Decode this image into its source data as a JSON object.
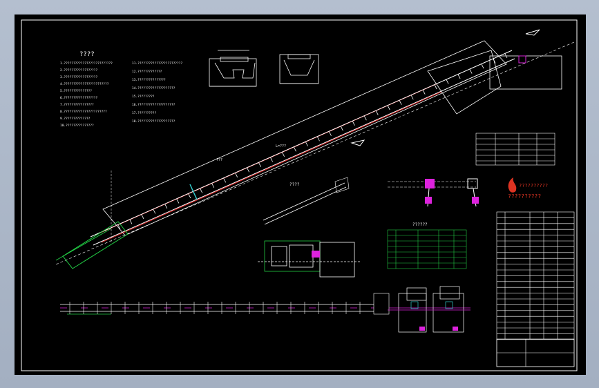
{
  "notes": {
    "heading": "????",
    "lines": [
      "1.??????????????????????????",
      "2.??????????????????",
      "3.??????????????????",
      "4.????????????????????????",
      "5.???????????????",
      "6.??????????????????",
      "7.????????????????",
      "8.???????????????????????",
      "9.??????????????",
      "10.???????????????"
    ],
    "lines2": [
      "11.????????????????????????",
      "12.?????????????",
      "13.???????????????",
      "14.????????????????????",
      "15.?????????",
      "16.????????????????????",
      "17.??????????",
      "18.????????????????????"
    ]
  },
  "conveyor": {
    "length_label": "L=???",
    "incline_label": "???"
  },
  "callouts": {
    "detail_a": "????",
    "detail_table": "??????",
    "legend": "?????????",
    "logo_text": "??????????"
  },
  "colors": {
    "sheet": "#000000",
    "line": "#ffffff",
    "belt": "#cc2222",
    "green": "#22cc44",
    "magenta": "#dd22dd",
    "cyan": "#33cccc"
  }
}
